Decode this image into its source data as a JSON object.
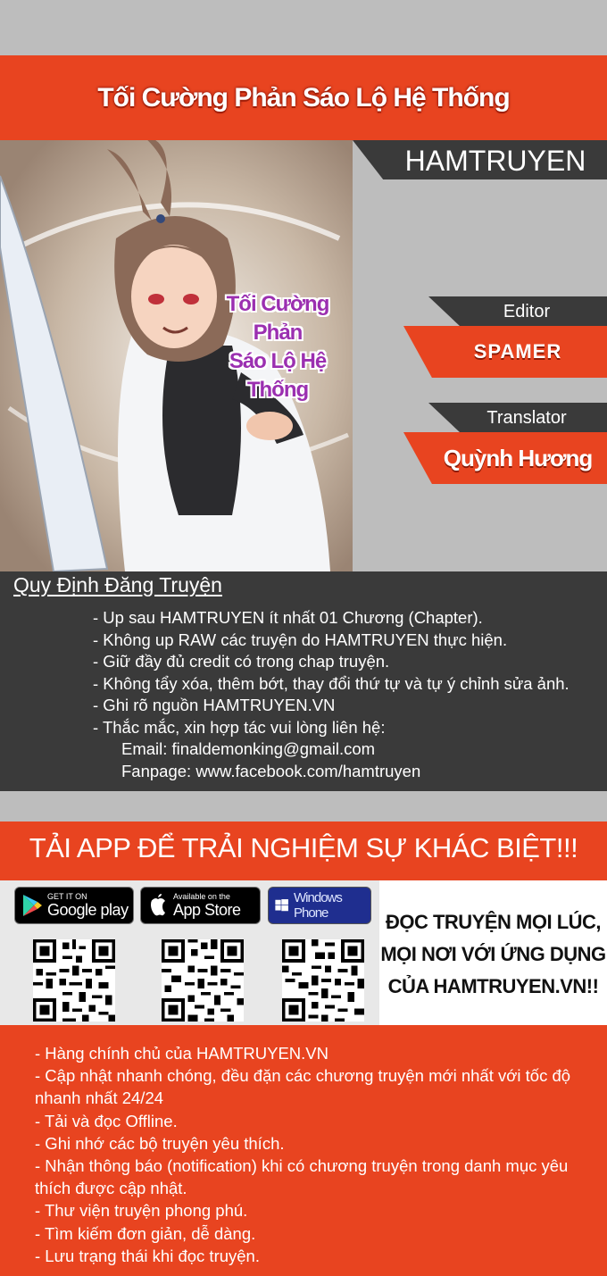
{
  "header": {
    "title": "Tối Cường Phản Sáo Lộ Hệ Thống"
  },
  "cover": {
    "title_line1": "Tối Cường Phản",
    "title_line2": "Sáo Lộ Hệ Thống"
  },
  "brand": "HAMTRUYEN",
  "credits": {
    "editor_label": "Editor",
    "editor_name": "SPAMER",
    "translator_label": "Translator",
    "translator_name": "Quỳnh Hương"
  },
  "rules": {
    "heading": "Quy Định Đăng Truyện",
    "items": [
      "- Up sau HAMTRUYEN ít nhất 01 Chương (Chapter).",
      "- Không up RAW các truyện do HAMTRUYEN thực hiện.",
      "- Giữ đầy đủ credit có trong chap truyện.",
      "- Không tẩy xóa, thêm bớt, thay đổi thứ tự và tự ý chỉnh sửa ảnh.",
      "- Ghi rõ nguồn HAMTRUYEN.VN",
      "- Thắc mắc, xin hợp tác vui lòng liên hệ:"
    ],
    "email": "Email: finaldemonking@gmail.com",
    "fanpage": "Fanpage: www.facebook.com/hamtruyen"
  },
  "app": {
    "header": "TẢI APP ĐỂ TRẢI NGHIỆM SỰ KHÁC BIỆT!!!",
    "google_small": "GET IT ON",
    "google_big": "Google play",
    "apple_small": "Available on the",
    "apple_big": "App Store",
    "windows": "Windows Phone",
    "promo_line1": "ĐỌC TRUYỆN MỌI LÚC,",
    "promo_line2": "MỌI NƠI VỚI ỨNG DỤNG",
    "promo_line3": "CỦA HAMTRUYEN.VN!!"
  },
  "features": [
    "- Hàng chính chủ của HAMTRUYEN.VN",
    "- Cập nhật nhanh chóng, đều đặn các chương truyện mới nhất với tốc độ nhanh nhất 24/24",
    "- Tải và đọc Offline.",
    "- Ghi nhớ các bộ truyện yêu thích.",
    "- Nhận thông báo (notification) khi có chương truyện trong danh mục yêu thích được cập nhật.",
    "- Thư viện truyện phong phú.",
    "- Tìm kiếm đơn giản, dễ dàng.",
    "- Lưu trạng thái khi đọc truyện."
  ],
  "colors": {
    "accent_red": "#e84420",
    "panel_dark": "#3a3a3a",
    "panel_gray": "#bdbdbd",
    "cover_title": "#9b2fb0"
  }
}
